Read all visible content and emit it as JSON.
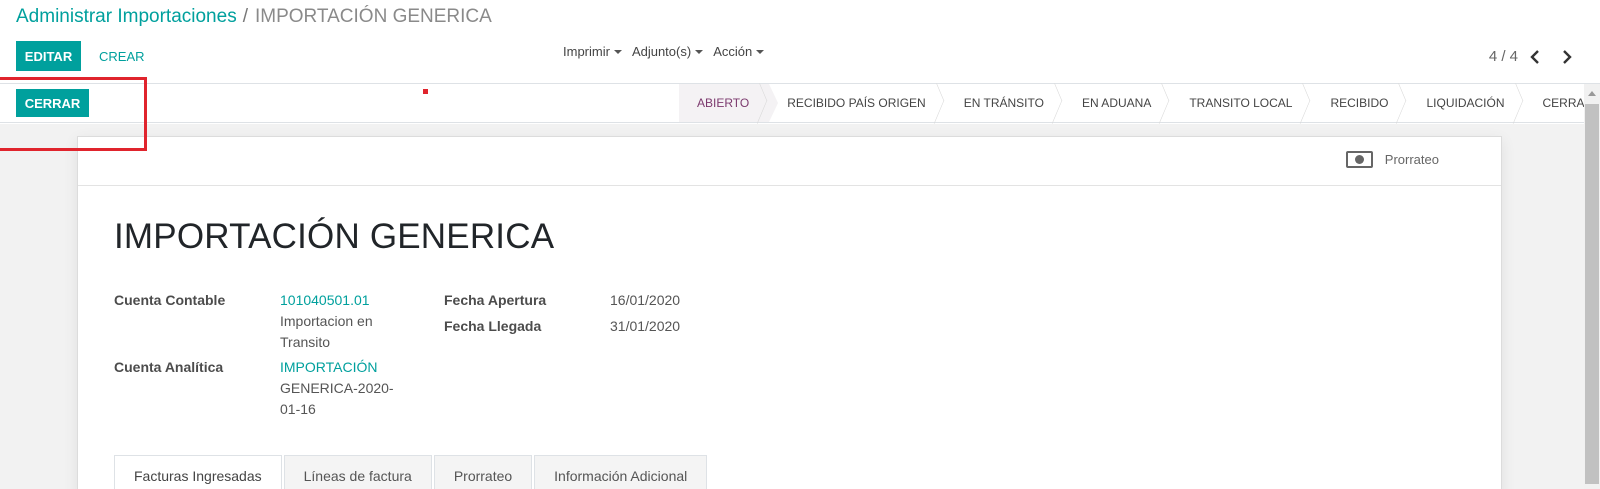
{
  "breadcrumb": {
    "parent": "Administrar Importaciones",
    "separator": "/",
    "current": "IMPORTACIÓN GENERICA"
  },
  "toolbar": {
    "edit_label": "EDITAR",
    "create_label": "CREAR",
    "menus": {
      "print": "Imprimir",
      "attachments": "Adjunto(s)",
      "action": "Acción"
    }
  },
  "pager": {
    "value": "4 / 4"
  },
  "statusbar": {
    "close_button": "CERRAR",
    "stages": [
      "ABIERTO",
      "RECIBIDO PAÍS ORIGEN",
      "EN TRÁNSITO",
      "EN ADUANA",
      "TRANSITO LOCAL",
      "RECIBIDO",
      "LIQUIDACIÓN",
      "CERRADO"
    ],
    "active_stage": "ABIERTO"
  },
  "smart_button": {
    "label": "Prorrateo",
    "icon": "money-icon"
  },
  "record": {
    "title": "IMPORTACIÓN GENERICA",
    "fields": {
      "cuenta_contable_label": "Cuenta Contable",
      "cuenta_contable_link": "101040501.01",
      "cuenta_contable_desc_1": "Importacion en",
      "cuenta_contable_desc_2": "Transito",
      "cuenta_analitica_label": "Cuenta Analítica",
      "cuenta_analitica_link": "IMPORTACIÓN",
      "cuenta_analitica_desc_1": "GENERICA-2020-",
      "cuenta_analitica_desc_2": "01-16",
      "fecha_apertura_label": "Fecha Apertura",
      "fecha_apertura_value": "16/01/2020",
      "fecha_llegada_label": "Fecha Llegada",
      "fecha_llegada_value": "31/01/2020"
    }
  },
  "tabs": [
    "Facturas Ingresadas",
    "Líneas de factura",
    "Prorrateo",
    "Información Adicional"
  ],
  "colors": {
    "primary": "#00A09D",
    "active_stage_text": "#7c3a6e",
    "highlight_red": "#e0242d"
  }
}
